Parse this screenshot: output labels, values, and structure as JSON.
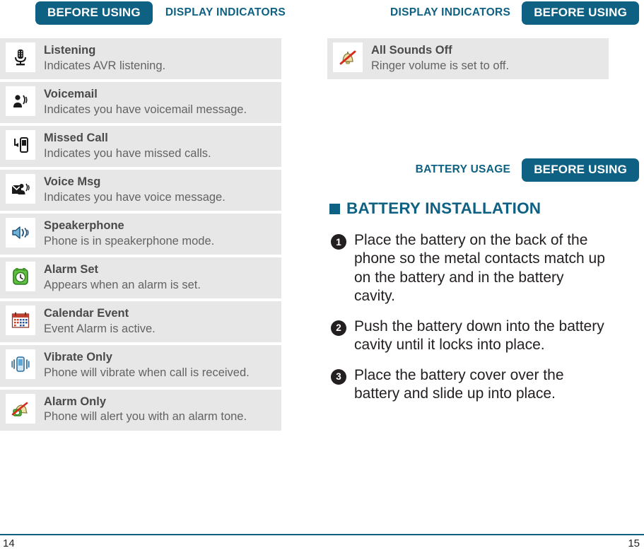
{
  "left_page": {
    "running_head": {
      "active_tab": "BEFORE USING",
      "section_tab": "DISPLAY INDICATORS"
    },
    "indicators": [
      {
        "icon": "microphone-icon",
        "title": "Listening",
        "description": "Indicates AVR listening."
      },
      {
        "icon": "voicemail-person-sound-icon",
        "title": "Voicemail",
        "description": "Indicates you have voicemail message."
      },
      {
        "icon": "missed-call-phone-arrow-icon",
        "title": "Missed Call",
        "description": "Indicates you have missed calls."
      },
      {
        "icon": "voice-message-envelope-icon",
        "title": "Voice Msg",
        "description": "Indicates you have voice message."
      },
      {
        "icon": "speakerphone-icon",
        "title": "Speakerphone",
        "description": "Phone is in speakerphone mode."
      },
      {
        "icon": "alarm-clock-icon",
        "title": "Alarm Set",
        "description": "Appears when an alarm is set."
      },
      {
        "icon": "calendar-icon",
        "title": "Calendar Event",
        "description": "Event Alarm is active."
      },
      {
        "icon": "vibrate-phone-icon",
        "title": "Vibrate Only",
        "description": "Phone will vibrate when call is received."
      },
      {
        "icon": "alarm-bell-only-icon",
        "title": "Alarm Only",
        "description": "Phone will alert you with an alarm tone."
      }
    ],
    "folio": "14"
  },
  "right_page": {
    "running_head": {
      "section_tab": "DISPLAY INDICATORS",
      "active_tab": "BEFORE USING"
    },
    "indicators": [
      {
        "icon": "bell-muted-icon",
        "title": "All Sounds Off",
        "description": "Ringer volume is set to off."
      }
    ],
    "battery_head": {
      "section_tab": "BATTERY USAGE",
      "active_tab": "BEFORE USING"
    },
    "section_title": "BATTERY INSTALLATION",
    "steps": [
      {
        "number": "1",
        "text": "Place the battery on the back of the phone so the metal contacts match up on the battery and in the battery cavity."
      },
      {
        "number": "2",
        "text": "Push the battery down into the battery cavity until it locks into place."
      },
      {
        "number": "3",
        "text": "Place the battery cover over the battery and slide up into place."
      }
    ],
    "folio": "15"
  },
  "colors": {
    "brand_teal": "#0e6183",
    "row_background": "#e7e7e7",
    "body_text": "#231f20"
  }
}
